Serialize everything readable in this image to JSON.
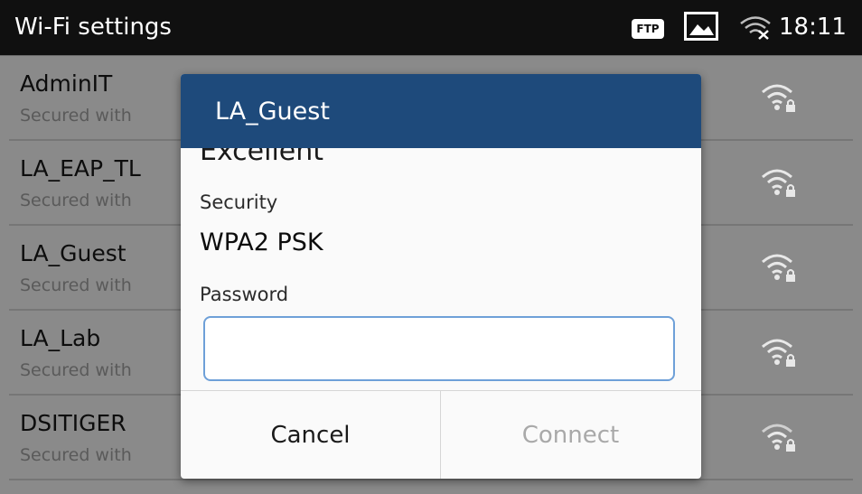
{
  "status_bar": {
    "title": "Wi-Fi settings",
    "ftp_badge": "FTP",
    "image_icon": "image-icon",
    "wifi_icon": "wifi-disconnected-icon",
    "time": "18:11"
  },
  "networks": [
    {
      "ssid": "AdminIT",
      "subtitle": "Secured with",
      "icon": "wifi-locked-icon"
    },
    {
      "ssid": "LA_EAP_TL",
      "subtitle": "Secured with",
      "icon": "wifi-locked-icon"
    },
    {
      "ssid": "LA_Guest",
      "subtitle": "Secured with",
      "icon": "wifi-locked-icon"
    },
    {
      "ssid": "LA_Lab",
      "subtitle": "Secured with",
      "icon": "wifi-locked-icon"
    },
    {
      "ssid": "DSITIGER",
      "subtitle": "Secured with",
      "icon": "wifi-locked-icon"
    }
  ],
  "dialog": {
    "title": "LA_Guest",
    "signal_value": "Excellent",
    "security_label": "Security",
    "security_value": "WPA2 PSK",
    "password_label": "Password",
    "password_value": "",
    "cancel_label": "Cancel",
    "connect_label": "Connect"
  },
  "colors": {
    "dialog_header": "#1e4a7b",
    "status_bar": "#101010",
    "input_border": "#6ea0d8",
    "disabled_text": "#a9a9a9"
  }
}
